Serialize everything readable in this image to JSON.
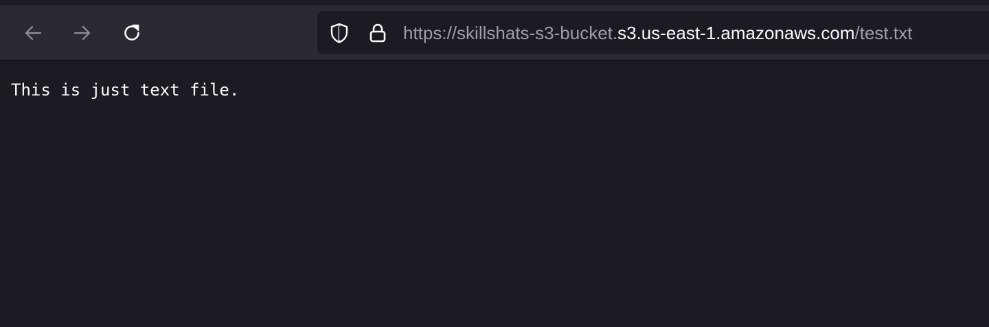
{
  "toolbar": {
    "back_icon": "arrow-left-icon",
    "forward_icon": "arrow-right-icon",
    "reload_icon": "reload-icon"
  },
  "urlbar": {
    "shield_icon": "tracking-protection-shield-icon",
    "lock_icon": "lock-icon",
    "url_prefix": "https://skillshats-s3-bucket.",
    "url_host": "s3.us-east-1.amazonaws.com",
    "url_path": "/test.txt"
  },
  "document": {
    "text": "This is just text file."
  },
  "colors": {
    "toolbar_bg": "#2b2a33",
    "page_bg": "#1c1b22",
    "text": "#fbfbfe",
    "dim_text": "#9e9ea6"
  }
}
